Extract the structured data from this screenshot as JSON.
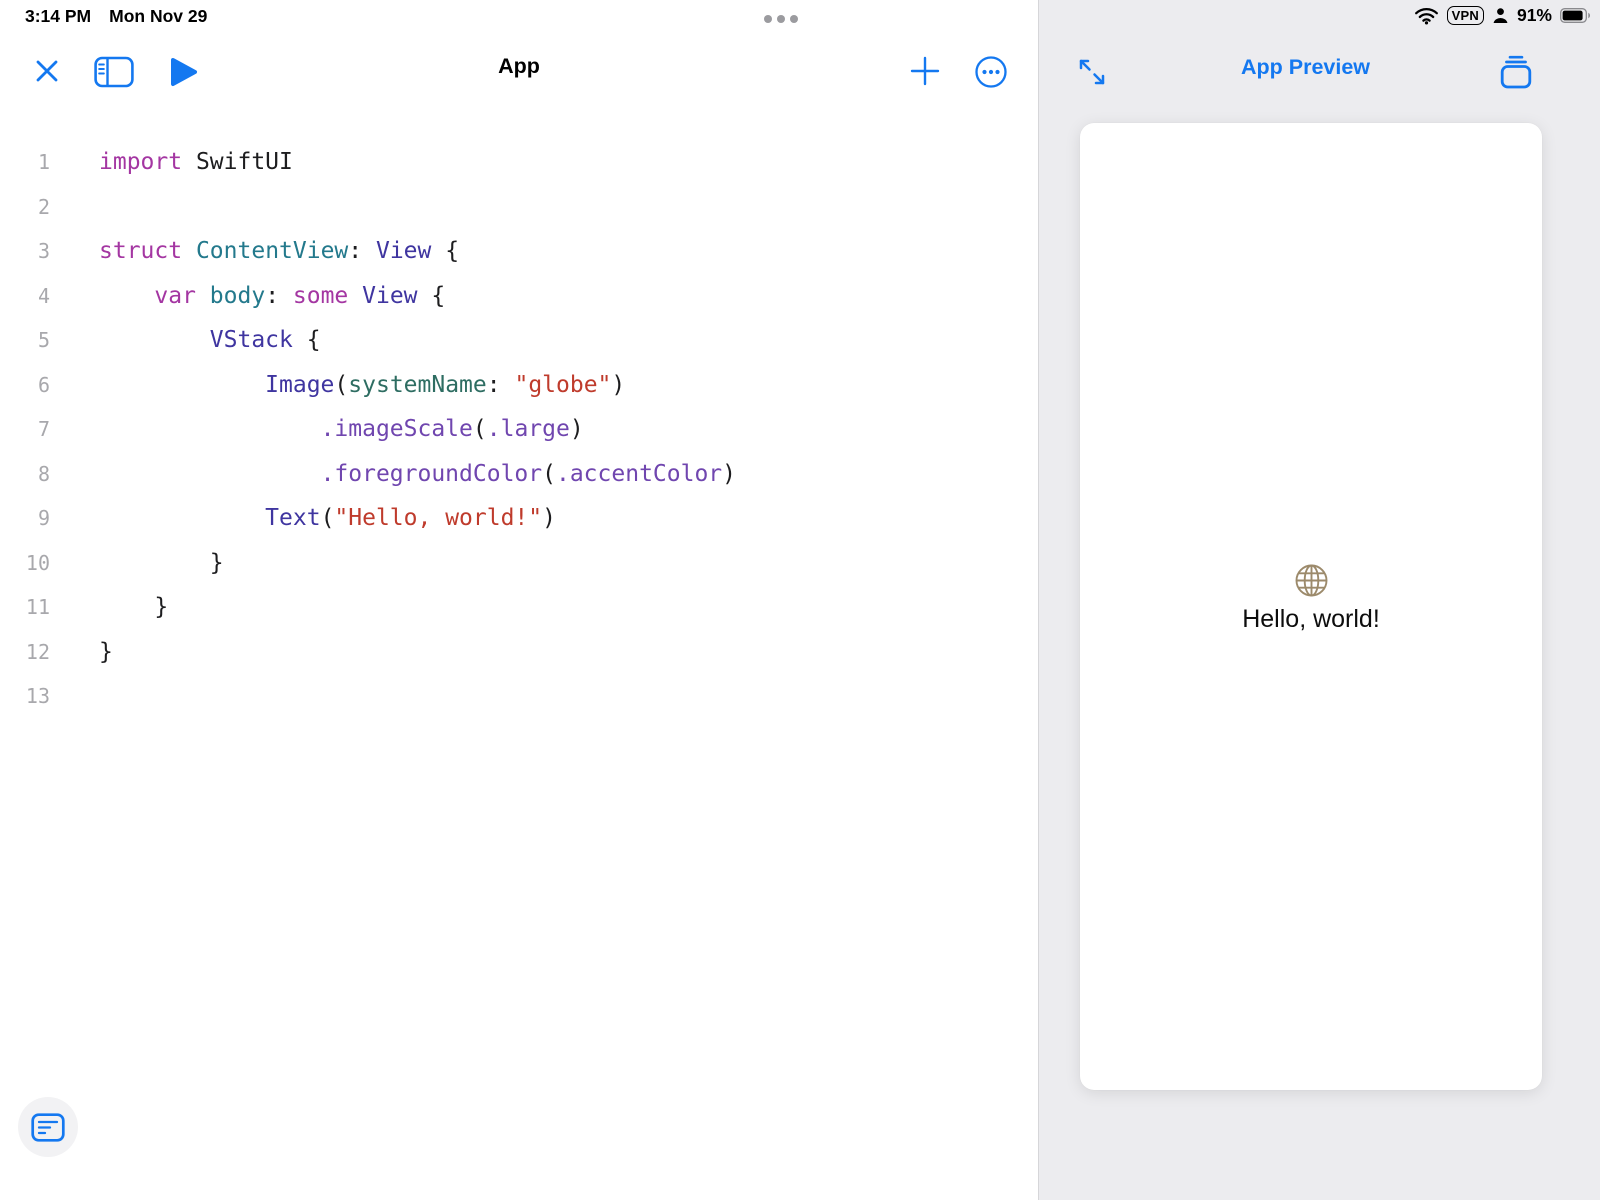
{
  "colors": {
    "accent_blue": "#1478f0",
    "panel_gray": "#ececef",
    "globe_tan": "#9c8a6b",
    "syntax": {
      "keyword": "#a436a2",
      "type": "#23798c",
      "ftype": "#3f35a0",
      "member": "#7046af",
      "string": "#bf3b2c",
      "arg": "#2e6d62",
      "plain": "#1d1d1f",
      "lineNumber": "#a8a8ac"
    }
  },
  "status_bar": {
    "time": "3:14 PM",
    "date": "Mon Nov 29",
    "vpn_label": "VPN",
    "battery_percent": "91%"
  },
  "icons": {
    "close-icon": "✕",
    "sidebar-icon": "left sidebar panel",
    "run-icon": "▶",
    "add-icon": "+",
    "more-icon": "ellipsis in circle",
    "expand-icon": "diagonal expand arrows",
    "app-gallery-icon": "stacked cards",
    "console-icon": "document with lines",
    "wifi-icon": "wifi waves",
    "user-icon": "person silhouette",
    "battery-icon": "battery 91% full",
    "globe-icon": "globe grid",
    "drag-handle-icon": "three dots"
  },
  "editor": {
    "title": "App"
  },
  "preview": {
    "title": "App Preview",
    "hello_text": "Hello, world!"
  },
  "code": {
    "lines": [
      {
        "num": "1",
        "tokens": [
          {
            "t": "import",
            "c": "keyword"
          },
          {
            "t": " SwiftUI",
            "c": "plain"
          }
        ]
      },
      {
        "num": "2",
        "tokens": []
      },
      {
        "num": "3",
        "tokens": [
          {
            "t": "struct",
            "c": "keyword"
          },
          {
            "t": " ",
            "c": "plain"
          },
          {
            "t": "ContentView",
            "c": "type"
          },
          {
            "t": ": ",
            "c": "plain"
          },
          {
            "t": "View",
            "c": "ftype"
          },
          {
            "t": " {",
            "c": "plain"
          }
        ]
      },
      {
        "num": "4",
        "tokens": [
          {
            "t": "    ",
            "c": "plain"
          },
          {
            "t": "var",
            "c": "keyword"
          },
          {
            "t": " ",
            "c": "plain"
          },
          {
            "t": "body",
            "c": "type"
          },
          {
            "t": ": ",
            "c": "plain"
          },
          {
            "t": "some",
            "c": "keyword"
          },
          {
            "t": " ",
            "c": "plain"
          },
          {
            "t": "View",
            "c": "ftype"
          },
          {
            "t": " {",
            "c": "plain"
          }
        ]
      },
      {
        "num": "5",
        "tokens": [
          {
            "t": "        ",
            "c": "plain"
          },
          {
            "t": "VStack",
            "c": "ftype"
          },
          {
            "t": " {",
            "c": "plain"
          }
        ]
      },
      {
        "num": "6",
        "tokens": [
          {
            "t": "            ",
            "c": "plain"
          },
          {
            "t": "Image",
            "c": "ftype"
          },
          {
            "t": "(",
            "c": "plain"
          },
          {
            "t": "systemName",
            "c": "arg"
          },
          {
            "t": ": ",
            "c": "plain"
          },
          {
            "t": "\"globe\"",
            "c": "string"
          },
          {
            "t": ")",
            "c": "plain"
          }
        ]
      },
      {
        "num": "7",
        "tokens": [
          {
            "t": "                ",
            "c": "plain"
          },
          {
            "t": ".imageScale",
            "c": "member"
          },
          {
            "t": "(",
            "c": "plain"
          },
          {
            "t": ".large",
            "c": "member"
          },
          {
            "t": ")",
            "c": "plain"
          }
        ]
      },
      {
        "num": "8",
        "tokens": [
          {
            "t": "                ",
            "c": "plain"
          },
          {
            "t": ".foregroundColor",
            "c": "member"
          },
          {
            "t": "(",
            "c": "plain"
          },
          {
            "t": ".accentColor",
            "c": "member"
          },
          {
            "t": ")",
            "c": "plain"
          }
        ]
      },
      {
        "num": "9",
        "tokens": [
          {
            "t": "            ",
            "c": "plain"
          },
          {
            "t": "Text",
            "c": "ftype"
          },
          {
            "t": "(",
            "c": "plain"
          },
          {
            "t": "\"Hello, world!\"",
            "c": "string"
          },
          {
            "t": ")",
            "c": "plain"
          }
        ]
      },
      {
        "num": "10",
        "tokens": [
          {
            "t": "        }",
            "c": "plain"
          }
        ]
      },
      {
        "num": "11",
        "tokens": [
          {
            "t": "    }",
            "c": "plain"
          }
        ]
      },
      {
        "num": "12",
        "tokens": [
          {
            "t": "}",
            "c": "plain"
          }
        ]
      },
      {
        "num": "13",
        "tokens": []
      }
    ]
  }
}
